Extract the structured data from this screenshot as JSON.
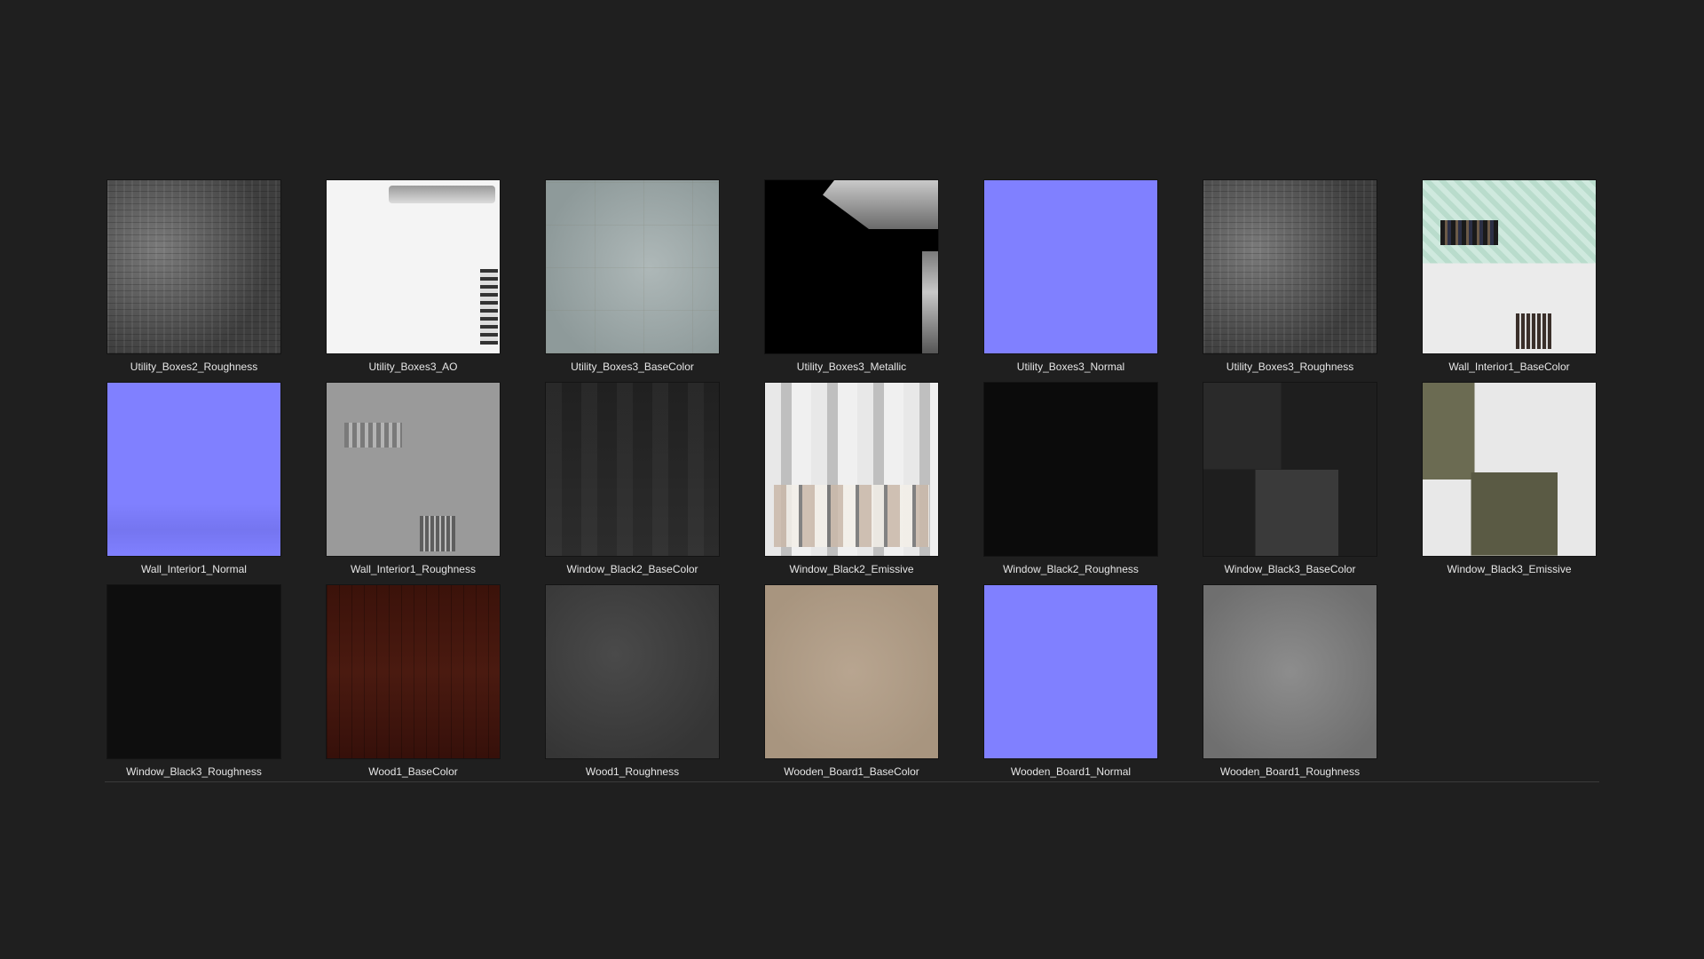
{
  "textures": [
    {
      "name": "Utility_Boxes2_Roughness",
      "look": "t-rough-a"
    },
    {
      "name": "Utility_Boxes3_AO",
      "look": "t-ao"
    },
    {
      "name": "Utility_Boxes3_BaseColor",
      "look": "t-basecolor-util"
    },
    {
      "name": "Utility_Boxes3_Metallic",
      "look": "t-metallic"
    },
    {
      "name": "Utility_Boxes3_Normal",
      "look": "t-normal"
    },
    {
      "name": "Utility_Boxes3_Roughness",
      "look": "t-rough-a"
    },
    {
      "name": "Wall_Interior1_BaseColor",
      "look": "t-wall-base"
    },
    {
      "name": "Wall_Interior1_Normal",
      "look": "t-normal-wall"
    },
    {
      "name": "Wall_Interior1_Roughness",
      "look": "t-wall-rough"
    },
    {
      "name": "Window_Black2_BaseColor",
      "look": "t-win2-base"
    },
    {
      "name": "Window_Black2_Emissive",
      "look": "t-win2-emis"
    },
    {
      "name": "Window_Black2_Roughness",
      "look": "t-dark"
    },
    {
      "name": "Window_Black3_BaseColor",
      "look": "t-win3-base"
    },
    {
      "name": "Window_Black3_Emissive",
      "look": "t-win3-emis"
    },
    {
      "name": "Window_Black3_Roughness",
      "look": "t-black3-rough"
    },
    {
      "name": "Wood1_BaseColor",
      "look": "t-wood-base"
    },
    {
      "name": "Wood1_Roughness",
      "look": "t-wood-rough"
    },
    {
      "name": "Wooden_Board1_BaseColor",
      "look": "t-board-base"
    },
    {
      "name": "Wooden_Board1_Normal",
      "look": "t-normal"
    },
    {
      "name": "Wooden_Board1_Roughness",
      "look": "t-board-rough"
    }
  ],
  "colors": {
    "background": "#1f1f1f",
    "label": "#e6e6e6",
    "normal_map": "#8080ff"
  }
}
